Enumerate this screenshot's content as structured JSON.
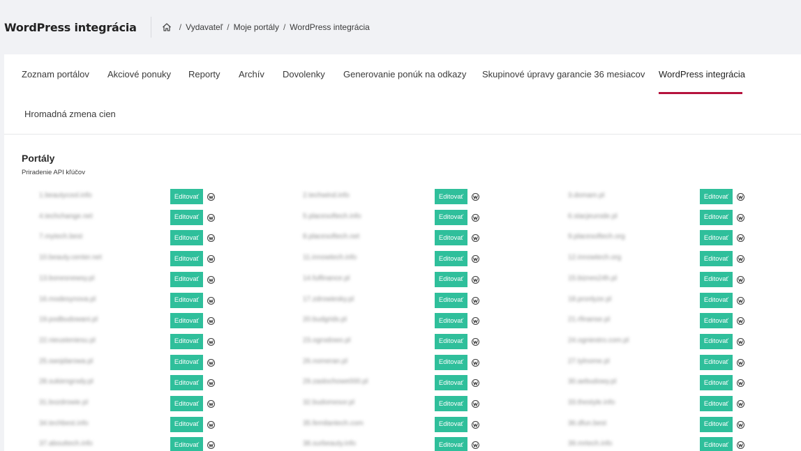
{
  "header": {
    "title": "WordPress integrácia",
    "breadcrumb": [
      "Vydavateľ",
      "Moje portály",
      "WordPress integrácia"
    ]
  },
  "tabs": [
    "Zoznam portálov",
    "Akciové ponuky",
    "Reporty",
    "Archív",
    "Dovolenky",
    "Generovanie ponúk na odkazy",
    "Skupinové úpravy garancie 36 mesiacov",
    "WordPress integrácia",
    "Hromadná zmena cien"
  ],
  "active_tab": "WordPress integrácia",
  "section": {
    "title": "Portály",
    "subtitle": "Priradenie API kľúčov"
  },
  "edit_label": "Editovať",
  "icon": "wordpress-icon",
  "colors": {
    "accent": "#b5123d",
    "button": "#2fbf9b"
  },
  "portals": [
    [
      "1.beautycool.info",
      "2.techwind.info",
      "3.domam.pl"
    ],
    [
      "4.techchange.net",
      "5.placesoftech.info",
      "6.stacjeurode.pl"
    ],
    [
      "7.mytech.best",
      "8.placesoftech.net",
      "9.placesoftech.org"
    ],
    [
      "10.beauty.center.net",
      "11.innowtech.info",
      "12.innowtech.org"
    ],
    [
      "13.bonesnewsy.pl",
      "14.fulfinance.pl",
      "15.biznes24h.pl"
    ],
    [
      "16.modesynova.pl",
      "17.zdrowiesky.pl",
      "18.pronlyze.pl"
    ],
    [
      "19.podbudowani.pl",
      "20.budgrids.pl",
      "21.rfinanse.pl"
    ],
    [
      "22.nieusteniesu.pl",
      "23.ogrodowo.pl",
      "24.ogniestro.com.pl"
    ],
    [
      "25.swojdarowa.pl",
      "26.nomeran.pl",
      "27.tylnome.pl"
    ],
    [
      "28.sukiengrody.pl",
      "29.zaslochowe000.pl",
      "30.aebudowy.pl"
    ],
    [
      "31.bozdrowie.pl",
      "32.budomesor.pl",
      "33.thestyle.info"
    ],
    [
      "34.techbest.info",
      "35.femilantech.com",
      "36.dfun.best"
    ],
    [
      "37.abouttech.info",
      "38.surbeauty.info",
      "39.mrtech.info"
    ]
  ]
}
